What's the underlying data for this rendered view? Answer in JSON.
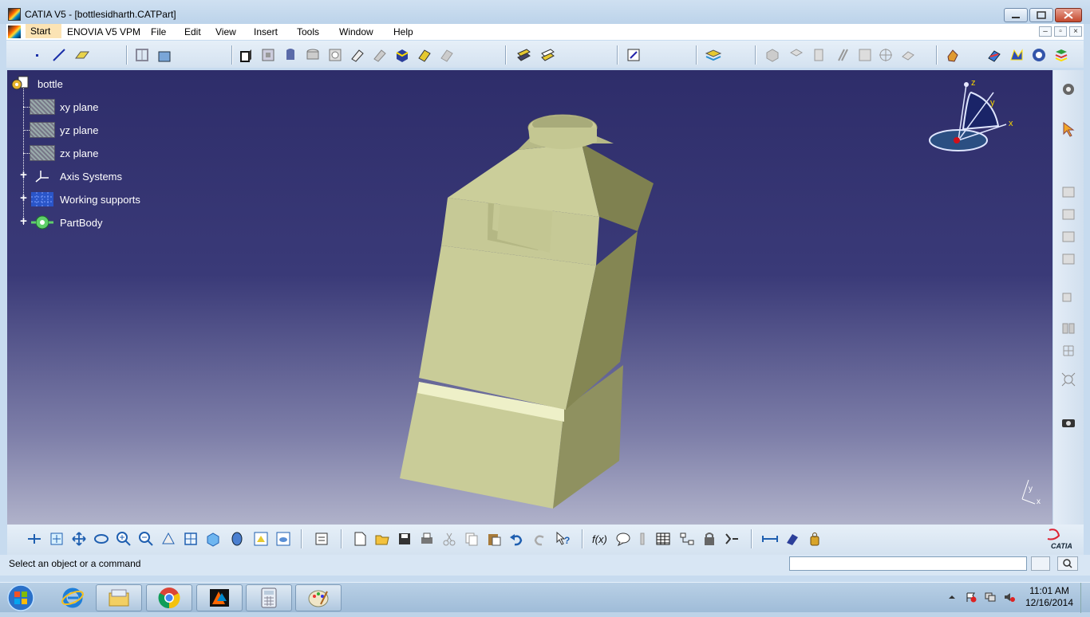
{
  "window": {
    "title": "CATIA V5 - [bottlesidharth.CATPart]"
  },
  "menu": {
    "items": [
      "Start",
      "ENOVIA V5 VPM",
      "File",
      "Edit",
      "View",
      "Insert",
      "Tools",
      "Window",
      "Help"
    ]
  },
  "tree": {
    "root": "bottle",
    "items": [
      {
        "label": "xy plane",
        "icon": "plane-icon"
      },
      {
        "label": "yz plane",
        "icon": "plane-icon"
      },
      {
        "label": "zx plane",
        "icon": "plane-icon"
      },
      {
        "label": "Axis Systems",
        "icon": "axis-system-icon",
        "expand": "+"
      },
      {
        "label": "Working supports",
        "icon": "working-support-icon",
        "expand": "+"
      },
      {
        "label": "PartBody",
        "icon": "partbody-icon",
        "expand": "+"
      }
    ]
  },
  "compass": {
    "x": "x",
    "y": "y",
    "z": "z"
  },
  "status": {
    "message": "Select an object or a command",
    "command_value": ""
  },
  "brand": {
    "logo_text": "CATIA"
  },
  "taskbar": {
    "time": "11:01 AM",
    "date": "12/16/2014"
  },
  "colors": {
    "viewport_top": "#2e2d6a",
    "part_color": "#c8cc98",
    "menu_start_bg": "#fbe3b4"
  }
}
